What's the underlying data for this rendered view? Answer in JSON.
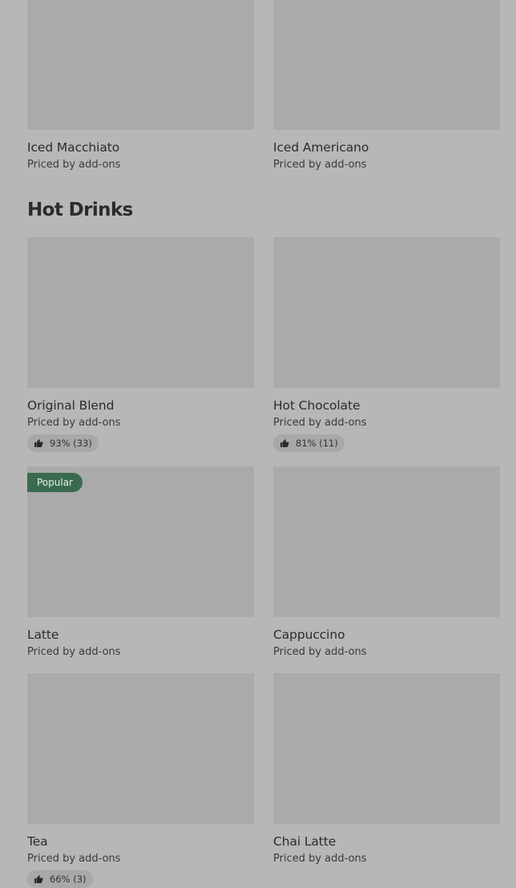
{
  "colors": {
    "background": "#b7b7b7",
    "image_placeholder": "#aaaaaa",
    "badge": "#3a6b4f",
    "rating_pill": "#a8a8a8"
  },
  "top_items": [
    {
      "name": "Iced Macchiato",
      "price": "Priced by add-ons"
    },
    {
      "name": "Iced Americano",
      "price": "Priced by add-ons"
    }
  ],
  "section": {
    "title": "Hot Drinks",
    "items": [
      {
        "name": "Original Blend",
        "price": "Priced by add-ons",
        "rating": "93% (33)",
        "rating_icon": "thumbs-up-icon"
      },
      {
        "name": "Hot Chocolate",
        "price": "Priced by add-ons",
        "rating": "81% (11)",
        "rating_icon": "thumbs-up-icon"
      },
      {
        "name": "Latte",
        "price": "Priced by add-ons",
        "badge": "Popular"
      },
      {
        "name": "Cappuccino",
        "price": "Priced by add-ons"
      },
      {
        "name": "Tea",
        "price": "Priced by add-ons",
        "rating": "66% (3)",
        "rating_icon": "thumbs-up-icon"
      },
      {
        "name": "Chai Latte",
        "price": "Priced by add-ons"
      }
    ]
  }
}
